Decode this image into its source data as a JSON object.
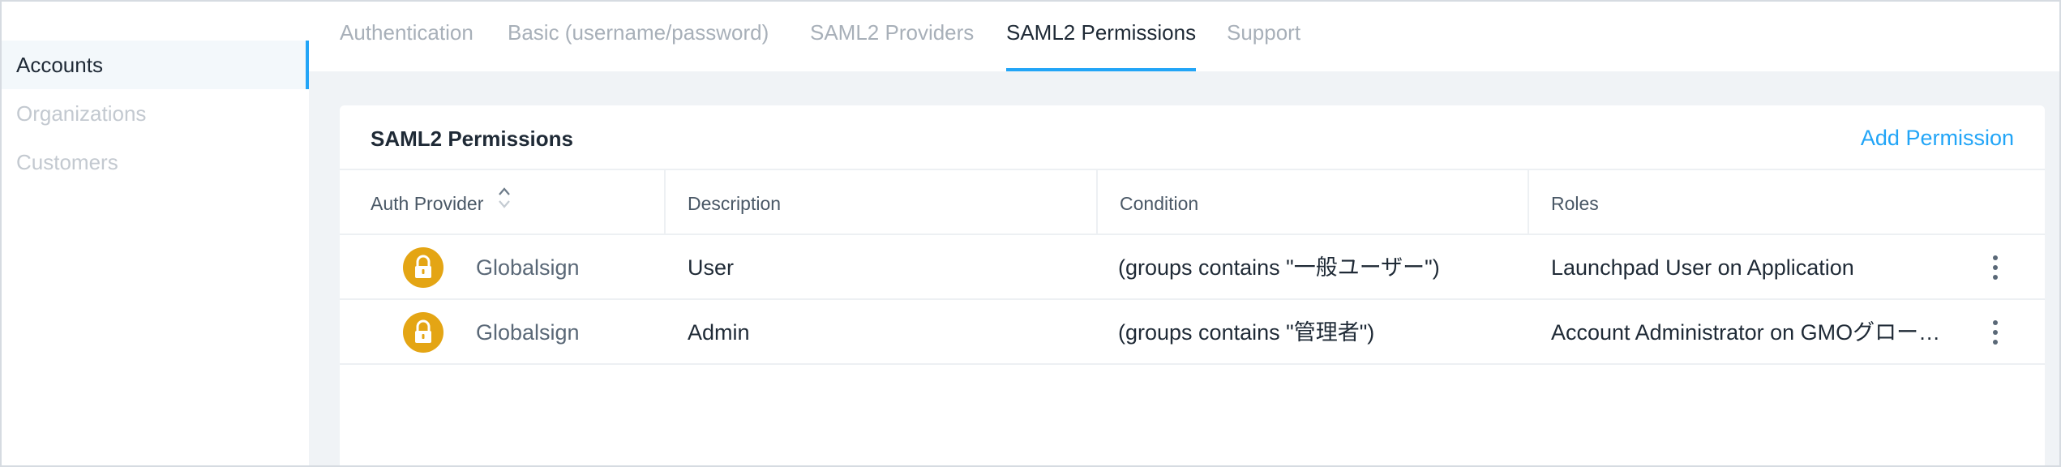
{
  "sidebar": {
    "items": [
      {
        "label": "Accounts",
        "active": true
      },
      {
        "label": "Organizations",
        "active": false
      },
      {
        "label": "Customers",
        "active": false
      }
    ]
  },
  "tabs": [
    {
      "label": "Authentication",
      "active": false
    },
    {
      "label": "Basic (username/password)",
      "active": false
    },
    {
      "label": "SAML2 Providers",
      "active": false
    },
    {
      "label": "SAML2 Permissions",
      "active": true
    },
    {
      "label": "Support",
      "active": false
    }
  ],
  "card": {
    "title": "SAML2 Permissions",
    "add_button": "Add Permission"
  },
  "table": {
    "columns": [
      "Auth Provider",
      "Description",
      "Condition",
      "Roles"
    ],
    "sort_icon": "sort-icon",
    "row_icon": "lock-icon",
    "rows": [
      {
        "provider": "Globalsign",
        "description": "User",
        "condition": "(groups contains \"一般ユーザー\")",
        "roles": "Launchpad User on Application"
      },
      {
        "provider": "Globalsign",
        "description": "Admin",
        "condition": "(groups contains \"管理者\")",
        "roles": "Account Administrator on GMOグロー…"
      }
    ]
  },
  "colors": {
    "accent": "#22a5f7",
    "lock_icon": "#e4a514",
    "muted_text": "#a8b0b9",
    "background": "#f0f3f6"
  }
}
